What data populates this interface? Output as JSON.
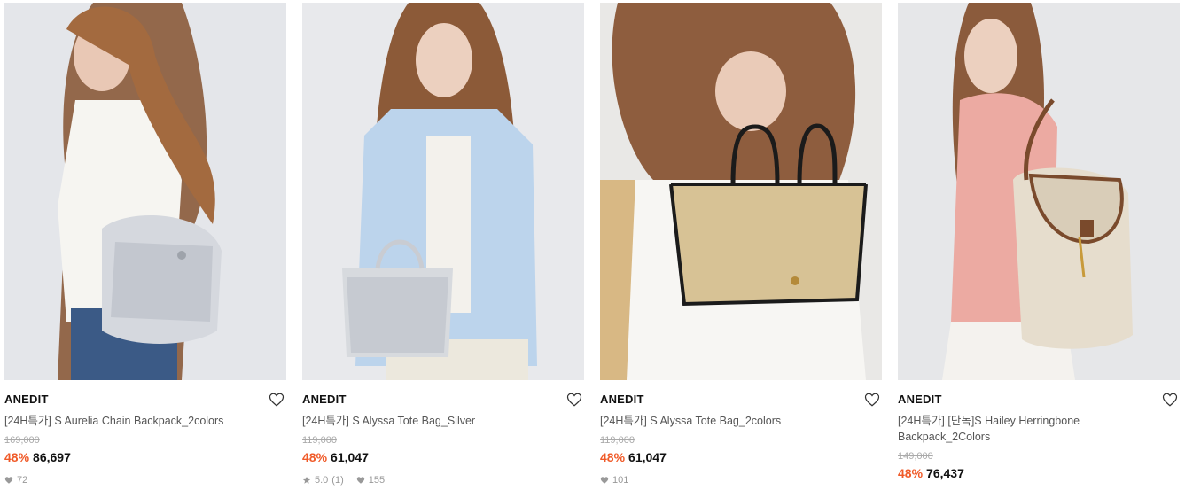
{
  "products": [
    {
      "brand": "ANEDIT",
      "title": "[24H특가] S Aurelia Chain Backpack_2colors",
      "original_price": "169,000",
      "discount": "48%",
      "sale_price": "86,697",
      "likes": "72",
      "rating": null,
      "reviews": null
    },
    {
      "brand": "ANEDIT",
      "title": "[24H특가] S Alyssa Tote Bag_Silver",
      "original_price": "119,000",
      "discount": "48%",
      "sale_price": "61,047",
      "likes": "155",
      "rating": "5.0",
      "reviews": "(1)"
    },
    {
      "brand": "ANEDIT",
      "title": "[24H특가] S Alyssa Tote Bag_2colors",
      "original_price": "119,000",
      "discount": "48%",
      "sale_price": "61,047",
      "likes": "101",
      "rating": null,
      "reviews": null
    },
    {
      "brand": "ANEDIT",
      "title": "[24H특가] [단독]S Hailey Herringbone Backpack_2Colors",
      "original_price": "149,000",
      "discount": "48%",
      "sale_price": "76,437",
      "likes": null,
      "rating": null,
      "reviews": null
    }
  ],
  "colors": {
    "discount": "#f05a28",
    "muted": "#999999"
  },
  "icons": {
    "wishlist": "heart-outline-icon",
    "likes": "heart-filled-icon",
    "rating": "star-icon"
  }
}
